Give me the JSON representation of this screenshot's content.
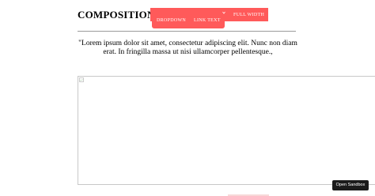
{
  "header": {
    "logo": "COMPOSITION"
  },
  "nav": {
    "items": [
      "DROPDOWN",
      "LINK TEXT",
      "FULL WIDTH"
    ],
    "caret_icon": "chevron-down-icon",
    "background_color": "#ff5a5a",
    "text_color": "#ffffff"
  },
  "content": {
    "quote_lines": [
      "\"Lorem ipsum dolor sit amet, consectetur adipiscing elit. Nunc non diam",
      "erat. In fringilla massa ut nisi ullamcorper pellentesque.,"
    ],
    "image_icon": "broken-image-icon"
  },
  "sandbox": {
    "label": "Open Sandbox"
  }
}
